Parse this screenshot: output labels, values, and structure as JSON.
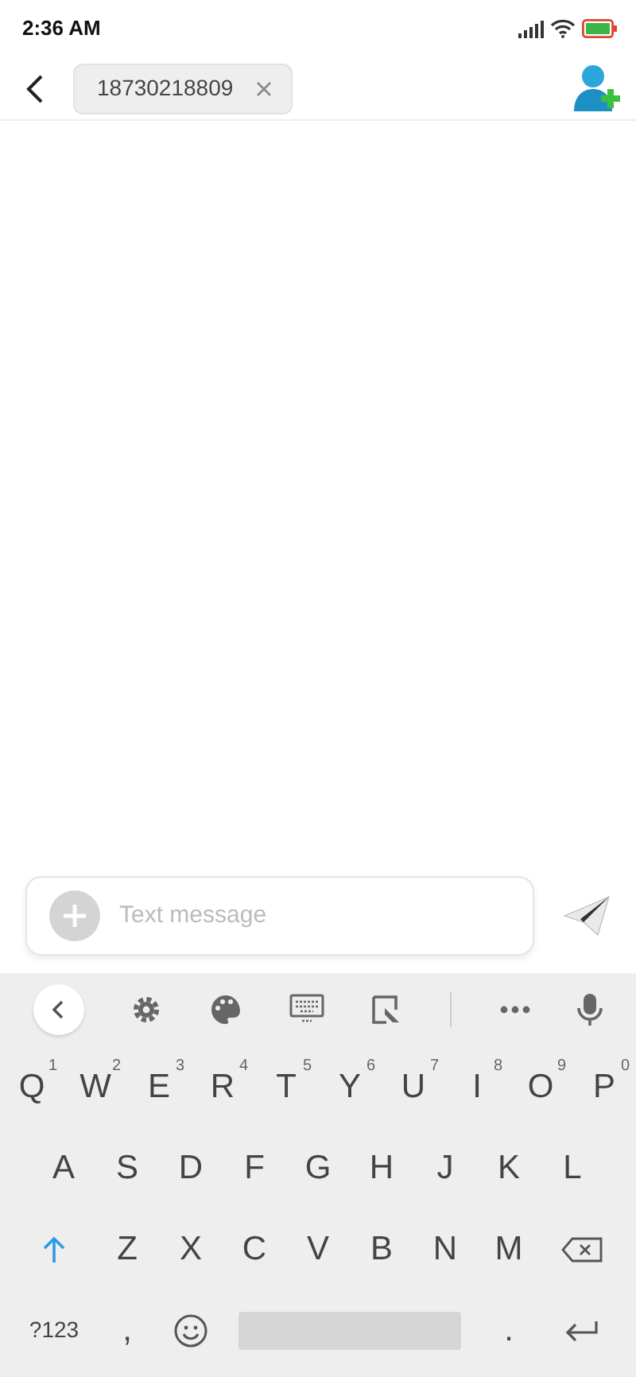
{
  "status_bar": {
    "time": "2:36 AM"
  },
  "header": {
    "recipient": "18730218809"
  },
  "composer": {
    "placeholder": "Text message"
  },
  "keyboard": {
    "rows": [
      {
        "keys": [
          {
            "kind": "letter",
            "label": "Q",
            "hint": "1"
          },
          {
            "kind": "letter",
            "label": "W",
            "hint": "2"
          },
          {
            "kind": "letter",
            "label": "E",
            "hint": "3"
          },
          {
            "kind": "letter",
            "label": "R",
            "hint": "4"
          },
          {
            "kind": "letter",
            "label": "T",
            "hint": "5"
          },
          {
            "kind": "letter",
            "label": "Y",
            "hint": "6"
          },
          {
            "kind": "letter",
            "label": "U",
            "hint": "7"
          },
          {
            "kind": "letter",
            "label": "I",
            "hint": "8"
          },
          {
            "kind": "letter",
            "label": "O",
            "hint": "9"
          },
          {
            "kind": "letter",
            "label": "P",
            "hint": "0"
          }
        ]
      },
      {
        "keys": [
          {
            "kind": "letter",
            "label": "A"
          },
          {
            "kind": "letter",
            "label": "S"
          },
          {
            "kind": "letter",
            "label": "D"
          },
          {
            "kind": "letter",
            "label": "F"
          },
          {
            "kind": "letter",
            "label": "G"
          },
          {
            "kind": "letter",
            "label": "H"
          },
          {
            "kind": "letter",
            "label": "J"
          },
          {
            "kind": "letter",
            "label": "K"
          },
          {
            "kind": "letter",
            "label": "L"
          }
        ]
      },
      {
        "keys": [
          {
            "kind": "shift"
          },
          {
            "kind": "letter",
            "label": "Z"
          },
          {
            "kind": "letter",
            "label": "X"
          },
          {
            "kind": "letter",
            "label": "C"
          },
          {
            "kind": "letter",
            "label": "V"
          },
          {
            "kind": "letter",
            "label": "B"
          },
          {
            "kind": "letter",
            "label": "N"
          },
          {
            "kind": "letter",
            "label": "M"
          },
          {
            "kind": "backspace"
          }
        ]
      },
      {
        "keys": [
          {
            "kind": "symbols",
            "label": "?123"
          },
          {
            "kind": "letter",
            "label": ","
          },
          {
            "kind": "emoji"
          },
          {
            "kind": "space"
          },
          {
            "kind": "letter",
            "label": "."
          },
          {
            "kind": "enter"
          }
        ]
      }
    ]
  }
}
